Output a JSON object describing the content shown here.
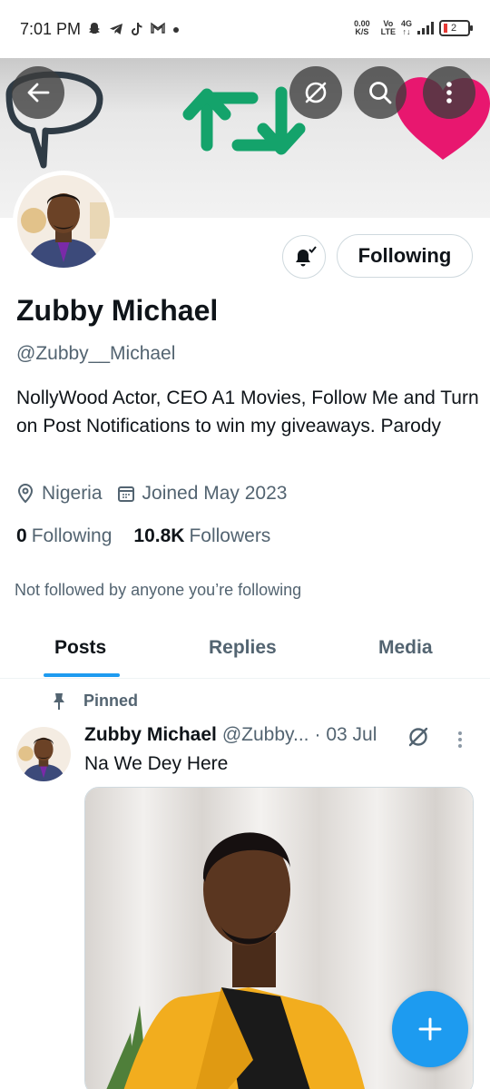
{
  "status_bar": {
    "time": "7:01 PM",
    "app_icons": [
      "snapchat-icon",
      "telegram-icon",
      "tiktok-icon",
      "gmail-icon",
      "dot-icon"
    ],
    "net_speed": "0.00",
    "net_unit": "K/S",
    "vo_lte_top": "Vo",
    "vo_lte_bottom": "LTE",
    "network": "4G",
    "battery": "2"
  },
  "header": {
    "back_icon": "back-arrow-icon",
    "grok_icon": "grok-icon",
    "search_icon": "search-icon",
    "more_icon": "more-vertical-icon"
  },
  "profile": {
    "follow_label": "Following",
    "bell_icon": "bell-icon",
    "name": "Zubby Michael",
    "handle": "@Zubby__Michael",
    "bio": "NollyWood Actor, CEO A1 Movies, Follow Me and Turn on Post Notifications to win my giveaways. Parody",
    "location": "Nigeria",
    "joined": "Joined May 2023",
    "following_count": "0",
    "following_label": "Following",
    "followers_count": "10.8K",
    "followers_label": "Followers",
    "not_followed_text": "Not followed by anyone you’re following"
  },
  "tabs": [
    {
      "label": "Posts",
      "active": true
    },
    {
      "label": "Replies",
      "active": false
    },
    {
      "label": "Media",
      "active": false
    }
  ],
  "post": {
    "pinned_label": "Pinned",
    "author_name": "Zubby Michael",
    "author_handle": "@Zubby...",
    "date": "· 03 Jul",
    "text": "Na We Dey Here"
  },
  "fab": {
    "icon": "plus-icon"
  },
  "colors": {
    "accent": "#1d9bf0",
    "text": "#0f1419",
    "secondary": "#536471",
    "banner_arrows": "#14a36b",
    "banner_heart": "#e8176f"
  }
}
